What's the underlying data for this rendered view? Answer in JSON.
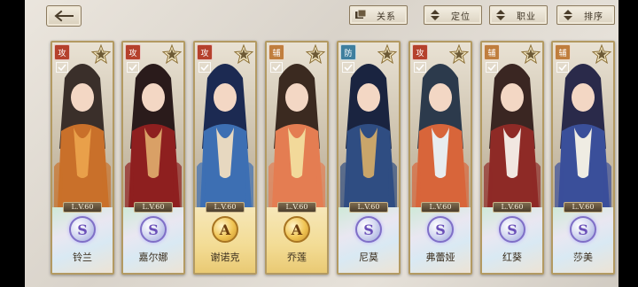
{
  "toolbar": {
    "back_icon": "back-arrow-icon",
    "buttons": [
      {
        "label": "关系",
        "icon": "relation-icon"
      },
      {
        "label": "定位",
        "icon": "sort-arrows-icon"
      },
      {
        "label": "职业",
        "icon": "sort-arrows-icon"
      },
      {
        "label": "排序",
        "icon": "sort-arrows-icon"
      }
    ]
  },
  "colors": {
    "frame": "#b39a62",
    "attack": "#b5412d",
    "support": "#c07e3e",
    "defense": "#3f7f9e"
  },
  "cards": [
    {
      "name": "铃兰",
      "role": "攻",
      "level": "L.V.60",
      "rank": "S",
      "theme": [
        "#3a2f2a",
        "#c9702a",
        "#e9a04a"
      ]
    },
    {
      "name": "嘉尔娜",
      "role": "攻",
      "level": "L.V.60",
      "rank": "S",
      "theme": [
        "#2a1b1b",
        "#8e1f1f",
        "#d9a066"
      ]
    },
    {
      "name": "谢诺克",
      "role": "攻",
      "level": "L.V.60",
      "rank": "A",
      "theme": [
        "#1c2a52",
        "#3d6fb3",
        "#e7d8c0"
      ]
    },
    {
      "name": "乔莲",
      "role": "辅",
      "level": "L.V.60",
      "rank": "A",
      "theme": [
        "#3b2a20",
        "#e47d52",
        "#f2d99a"
      ]
    },
    {
      "name": "尼莫",
      "role": "防",
      "level": "L.V.60",
      "rank": "S",
      "theme": [
        "#1a2440",
        "#2f4d82",
        "#c9a56a"
      ]
    },
    {
      "name": "弗蕾娅",
      "role": "攻",
      "level": "L.V.60",
      "rank": "S",
      "theme": [
        "#2c3a4c",
        "#d8653a",
        "#e8ecef"
      ]
    },
    {
      "name": "红葵",
      "role": "辅",
      "level": "L.V.60",
      "rank": "S",
      "theme": [
        "#3a2622",
        "#8e2a26",
        "#f1e7e1"
      ]
    },
    {
      "name": "莎美",
      "role": "辅",
      "level": "L.V.60",
      "rank": "S",
      "theme": [
        "#2a2a4a",
        "#3a4f9a",
        "#efece3"
      ]
    }
  ]
}
